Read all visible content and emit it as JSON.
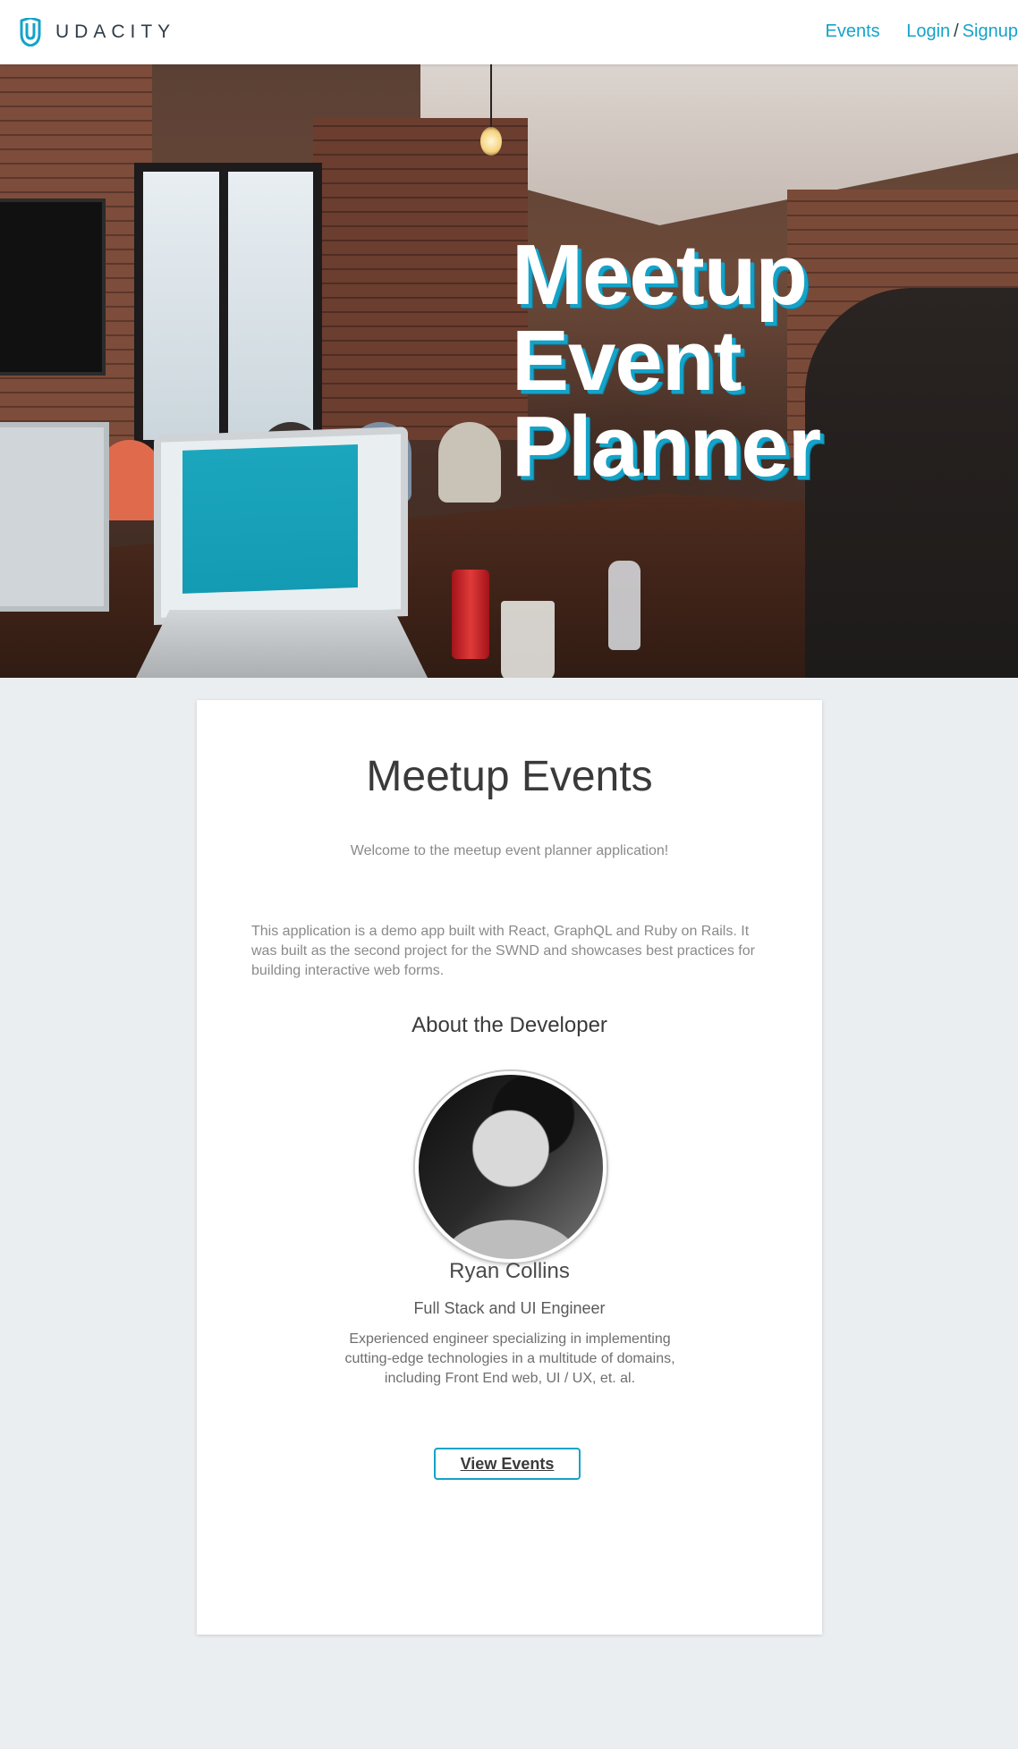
{
  "header": {
    "brand": "UDACITY",
    "nav": {
      "events": "Events",
      "login": "Login",
      "separator": "/",
      "signup": "Signup"
    },
    "accent_color": "#15a3c8"
  },
  "hero": {
    "title": "Meetup\nEvent\nPlanner",
    "image_icon": "meetup-photo"
  },
  "main": {
    "title": "Meetup Events",
    "welcome": "Welcome to the meetup event planner application!",
    "description": "This application is a demo app built with React, GraphQL and Ruby on Rails. It was built as the second project for the SWND and showcases best practices for building interactive web forms.",
    "about_heading": "About the Developer",
    "developer": {
      "name": "Ryan Collins",
      "role": "Full Stack and UI Engineer",
      "bio": "Experienced engineer specializing in implementing cutting-edge technologies in a multitude of domains, including Front End web, UI / UX, et. al."
    },
    "cta_label": "View Events"
  }
}
